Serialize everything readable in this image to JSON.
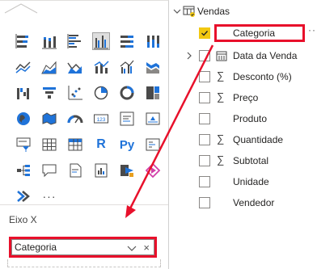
{
  "viz_pane": {
    "section_label": "Eixo X",
    "well_value": "Categoria",
    "well_remove": "×",
    "more_visuals": "···"
  },
  "fields_pane": {
    "table_name": "Vendas",
    "more_options": "···",
    "fields": [
      {
        "label": "Categoria",
        "checked": true
      },
      {
        "label": "Data da Venda",
        "checked": false
      },
      {
        "label": "Desconto (%)",
        "checked": false
      },
      {
        "label": "Preço",
        "checked": false
      },
      {
        "label": "Produto",
        "checked": false
      },
      {
        "label": "Quantidade",
        "checked": false
      },
      {
        "label": "Subtotal",
        "checked": false
      },
      {
        "label": "Unidade",
        "checked": false
      },
      {
        "label": "Vendedor",
        "checked": false
      }
    ],
    "sigma_symbol": "∑"
  },
  "colors": {
    "highlight": "#e8102b",
    "checkbox_checked": "#f2c811",
    "accent_blue": "#1f73d9"
  }
}
